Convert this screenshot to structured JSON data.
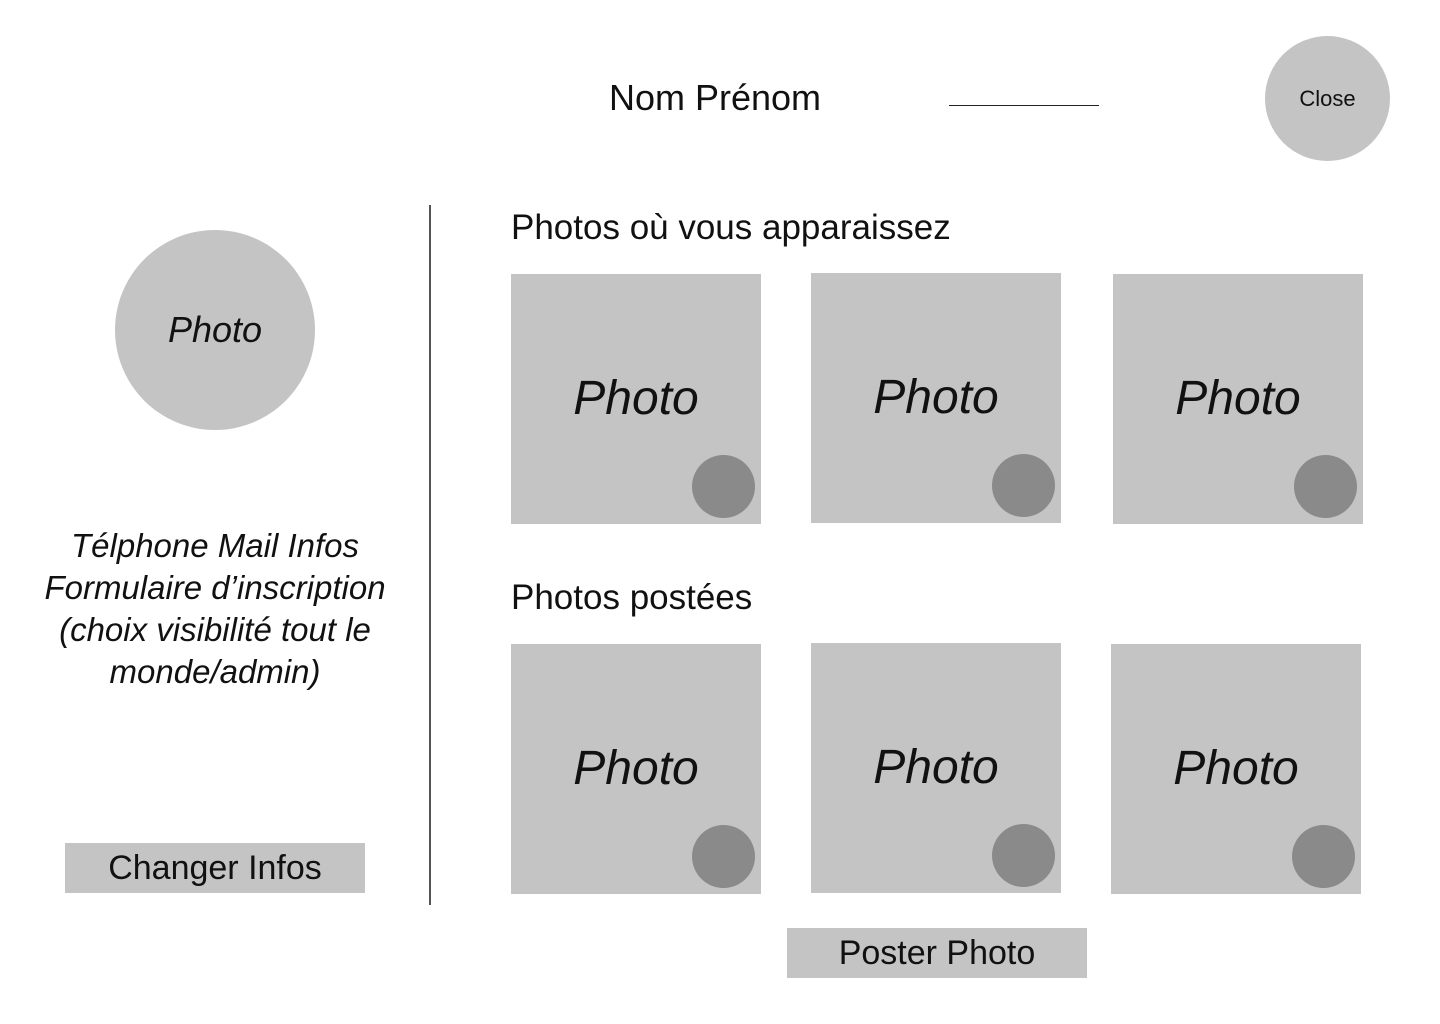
{
  "header": {
    "user_name": "Nom Prénom",
    "close_label": "Close"
  },
  "profile": {
    "photo_label": "Photo",
    "info_text": "Télphone Mail Infos Formulaire d’inscription (choix visibilité tout le monde/admin)",
    "change_info_label": "Changer Infos"
  },
  "tagged_section": {
    "title": "Photos où vous apparaissez",
    "photos": [
      {
        "label": "Photo"
      },
      {
        "label": "Photo"
      },
      {
        "label": "Photo"
      }
    ]
  },
  "posted_section": {
    "title": "Photos postées",
    "photos": [
      {
        "label": "Photo"
      },
      {
        "label": "Photo"
      },
      {
        "label": "Photo"
      }
    ]
  },
  "post_photo_label": "Poster Photo",
  "colors": {
    "placeholder": "#c4c4c4",
    "dot": "#8a8a8a",
    "text": "#111111"
  }
}
